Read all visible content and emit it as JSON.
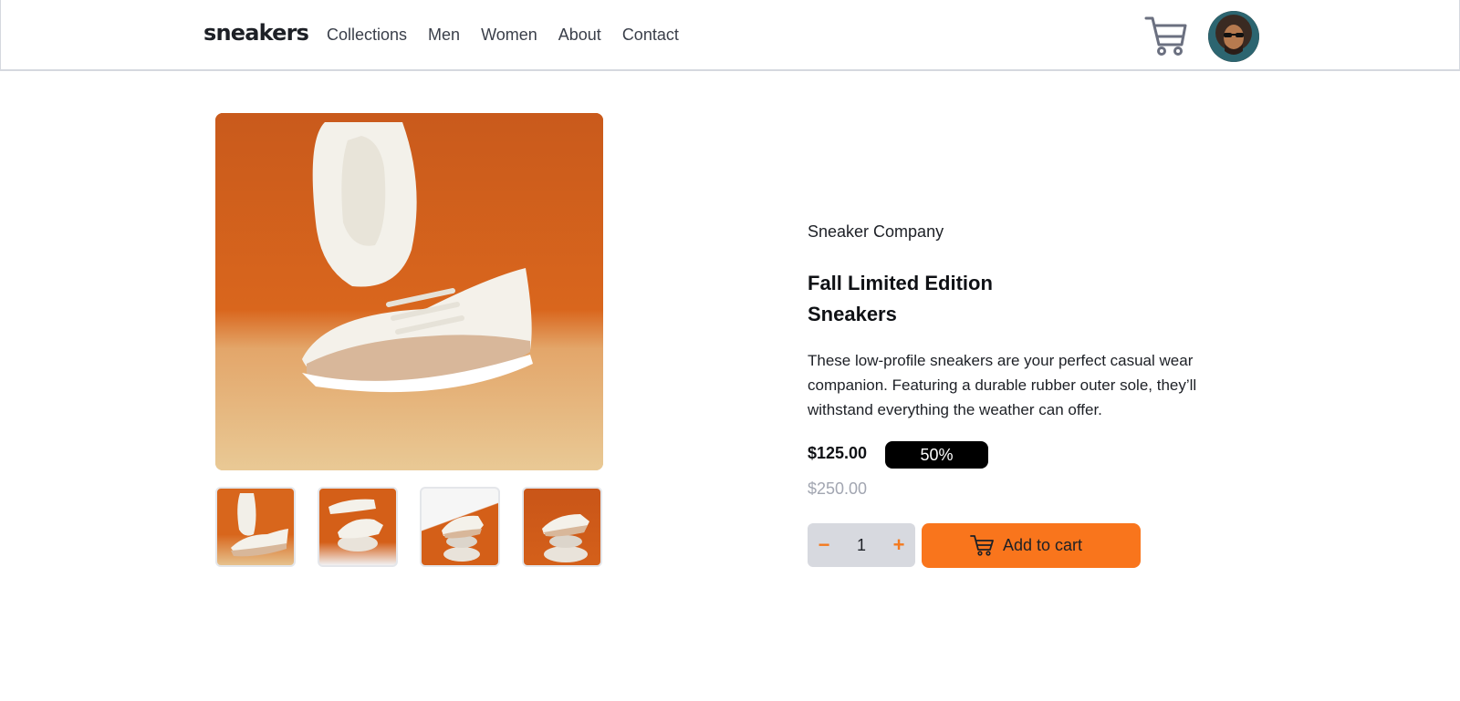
{
  "header": {
    "logo": "sneakers",
    "nav": [
      "Collections",
      "Men",
      "Women",
      "About",
      "Contact"
    ]
  },
  "product": {
    "company": "Sneaker Company",
    "title_line1": "Fall Limited Edition",
    "title_line2": "Sneakers",
    "description": "These low-profile sneakers are your perfect casual wear companion. Featuring a durable rubber outer sole, they’ll withstand everything the weather can offer.",
    "price": "$125.00",
    "discount": "50%",
    "old_price": "$250.00"
  },
  "cart_controls": {
    "minus": "−",
    "quantity": "1",
    "plus": "+",
    "add_label": "Add to cart"
  },
  "colors": {
    "accent": "#f9751c",
    "text": "#1d2026",
    "muted": "#a2a6b1",
    "qty_bg": "#d7d9df"
  }
}
